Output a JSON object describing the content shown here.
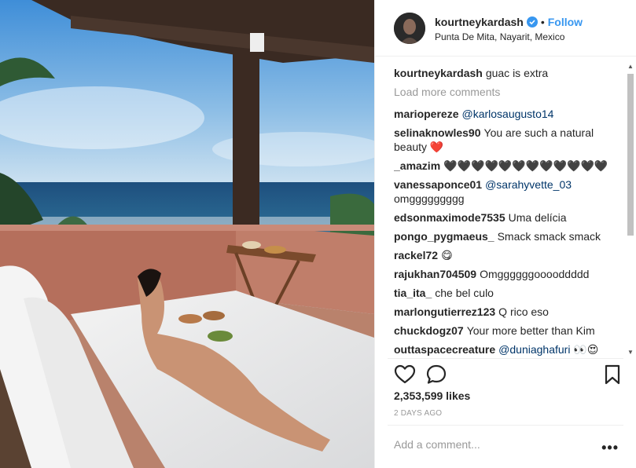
{
  "post": {
    "username": "kourtneykardash",
    "follow_label": "Follow",
    "separator": "•",
    "location": "Punta De Mita, Nayarit, Mexico",
    "caption": {
      "user": "kourtneykardash",
      "text": "guac is extra"
    },
    "load_more": "Load more comments",
    "comments": [
      {
        "user": "mariopereze",
        "text": "",
        "mention": "@karlosaugusto14"
      },
      {
        "user": "selinaknowles90",
        "text": "You are such a natural beauty ❤️",
        "mention": ""
      },
      {
        "user": "_amazim",
        "text": "🖤🖤🖤🖤🖤🖤🖤🖤🖤🖤🖤🖤",
        "mention": ""
      },
      {
        "user": "vanessaponce01",
        "text": "omggggggggg",
        "mention": "@sarahyvette_03"
      },
      {
        "user": "edsonmaximode7535",
        "text": "Uma delícia",
        "mention": ""
      },
      {
        "user": "pongo_pygmaeus_",
        "text": "Smack smack smack",
        "mention": ""
      },
      {
        "user": "rackel72",
        "text": "😋",
        "mention": ""
      },
      {
        "user": "rajukhan704509",
        "text": "Omggggggooooddddd",
        "mention": ""
      },
      {
        "user": "tia_ita_",
        "text": "che bel culo",
        "mention": ""
      },
      {
        "user": "marlongutierrez123",
        "text": "Q rico eso",
        "mention": ""
      },
      {
        "user": "chuckdogz07",
        "text": "Your more better than Kim",
        "mention": ""
      },
      {
        "user": "outtaspacecreature",
        "text": "👀😍",
        "mention": "@duniaghafuri"
      }
    ],
    "likes": "2,353,599 likes",
    "time_ago": "2 DAYS AGO",
    "add_comment_placeholder": "Add a comment...",
    "more_label": "•••"
  },
  "icons": {
    "like": "heart-icon",
    "comment": "comment-icon",
    "save": "bookmark-icon",
    "verified": "verified-badge-icon"
  },
  "colors": {
    "link": "#3897f0",
    "verified": "#3897f0",
    "muted": "#999999",
    "mention": "#003569"
  }
}
